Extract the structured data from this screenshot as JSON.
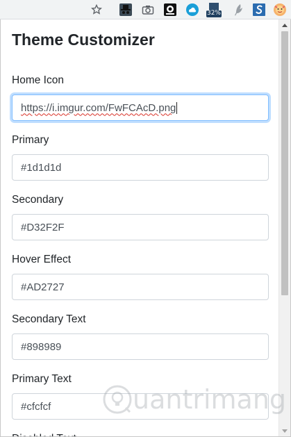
{
  "toolbar": {
    "icons": [
      "star-icon",
      "incognito-extension-icon",
      "camera-icon",
      "media-extension-icon",
      "cloud-extension-icon",
      "badge-extension-icon",
      "feather-extension-icon",
      "s-extension-icon",
      "profile-avatar-icon"
    ],
    "badge_text": "32%"
  },
  "popup": {
    "title": "Theme Customizer",
    "fields": [
      {
        "label": "Home Icon",
        "value": "https://i.imgur.com/FwFCAcD.png"
      },
      {
        "label": "Primary",
        "value": "#1d1d1d"
      },
      {
        "label": "Secondary",
        "value": "#D32F2F"
      },
      {
        "label": "Hover Effect",
        "value": "#AD2727"
      },
      {
        "label": "Secondary Text",
        "value": "#898989"
      },
      {
        "label": "Primary Text",
        "value": "#cfcfcf"
      },
      {
        "label": "Disabled Text",
        "value": ""
      }
    ]
  },
  "watermark": {
    "text": "uantrimang"
  },
  "colors": {
    "focus_border": "#80bdff",
    "spellcheck": "#d93025",
    "toolbar_bg": "#f1f3f4"
  }
}
